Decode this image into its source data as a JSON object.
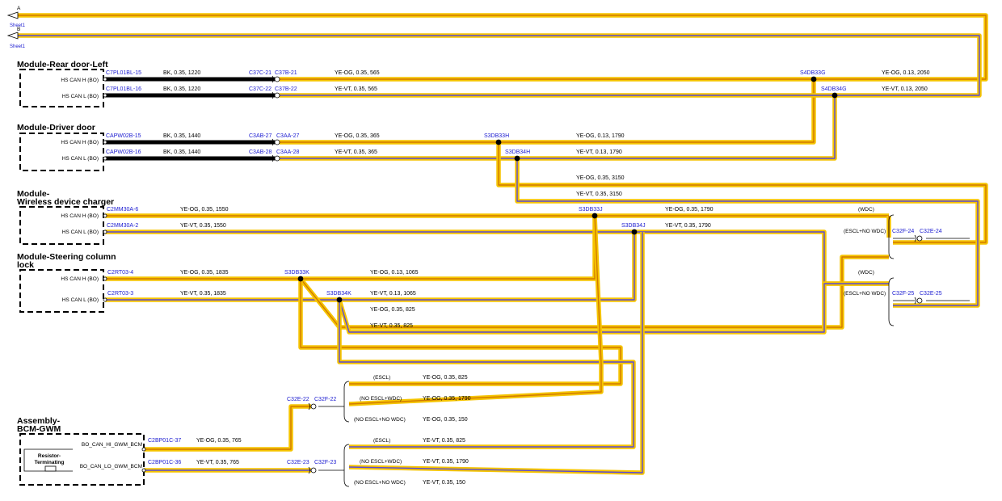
{
  "colors": {
    "yellow": "#f5c400",
    "orange": "#d27a00",
    "violet": "#5a4ad8",
    "black": "#000000",
    "link": "#1a1ad0"
  },
  "offsheet": [
    {
      "letter": "A",
      "sheet": "Sheet1"
    },
    {
      "letter": "B",
      "sheet": "Sheet1"
    }
  ],
  "modules": [
    {
      "title": "Module-Rear door-Left",
      "pins": [
        "HS CAN H (BO)",
        "HS CAN L (BO)"
      ]
    },
    {
      "title": "Module-Driver door",
      "pins": [
        "HS CAN H (BO)",
        "HS CAN L (BO)"
      ]
    },
    {
      "title": "Module-",
      "title2": "Wireless device charger",
      "pins": [
        "HS CAN H (BO)",
        "HS CAN L (BO)"
      ]
    },
    {
      "title": "Module-Steering column",
      "title2": "lock",
      "pins": [
        "HS CAN H (BO)",
        "HS CAN L (BO)"
      ]
    },
    {
      "title": "Assembly-",
      "title2": "BCM-GWM",
      "pins": [
        "BO_CAN_HI_GWM_BCM",
        "BO_CAN_LO_GWM_BCM"
      ],
      "resistor": "Resistor-",
      "resistor2": "Terminating"
    }
  ],
  "connectors": [
    "C7PL01BL-15",
    "C7PL01BL-16",
    "C37C-21",
    "C37B-21",
    "C37C-22",
    "C37B-22",
    "S4DB33G",
    "S4DB34G",
    "CAPW02B-15",
    "CAPW02B-16",
    "C3AB-27",
    "C3AA-27",
    "C3AB-28",
    "C3AA-28",
    "S3DB33H",
    "S3DB34H",
    "C2MM30A-6",
    "C2MM30A-2",
    "S3DB33J",
    "S3DB34J",
    "C32F-24",
    "C32E-24",
    "C2RT03-4",
    "C2RT03-3",
    "S3DB33K",
    "S3DB34K",
    "C32F-25",
    "C32E-25",
    "C2BP01C-37",
    "C2BP01C-36",
    "C32E-22",
    "C32F-22",
    "C32E-23",
    "C32F-23"
  ],
  "wire_specs": [
    "BK, 0.35, 1220",
    "BK, 0.35, 1220",
    "YE-OG, 0.35, 565",
    "YE-VT, 0.35, 565",
    "YE-OG, 0.13, 2050",
    "YE-VT, 0.13, 2050",
    "BK, 0.35, 1440",
    "BK, 0.35, 1440",
    "YE-OG, 0.35, 365",
    "YE-VT, 0.35, 365",
    "YE-OG, 0.13, 1790",
    "YE-VT, 0.13, 1790",
    "YE-OG, 0.35, 3150",
    "YE-VT, 0.35, 3150",
    "YE-OG, 0.35, 1550",
    "YE-VT, 0.35, 1550",
    "YE-OG, 0.35, 1790",
    "YE-VT, 0.35, 1790",
    "YE-OG, 0.35, 1835",
    "YE-VT, 0.35, 1835",
    "YE-OG, 0.13, 1065",
    "YE-VT, 0.13, 1065",
    "YE-OG, 0.35, 825",
    "YE-VT, 0.35, 825",
    "YE-OG, 0.35, 765",
    "YE-VT, 0.35, 765",
    "YE-OG, 0.35, 825",
    "YE-OG, 0.35, 1790",
    "YE-OG, 0.35, 150",
    "YE-VT, 0.35, 825",
    "YE-VT, 0.35, 1790",
    "YE-VT, 0.35, 150"
  ],
  "variants": [
    "(WDC)",
    "(ESCL+NO WDC)",
    "(WDC)",
    "(ESCL+NO WDC)",
    "(ESCL)",
    "(NO ESCL+WDC)",
    "(NO ESCL+NO WDC)",
    "(ESCL)",
    "(NO ESCL+WDC)",
    "(NO ESCL+NO WDC)"
  ]
}
